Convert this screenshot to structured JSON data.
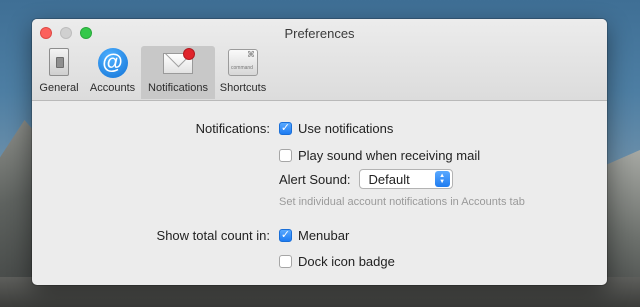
{
  "window": {
    "title": "Preferences"
  },
  "toolbar": {
    "items": [
      {
        "label": "General",
        "icon": "general-switch-icon"
      },
      {
        "label": "Accounts",
        "icon": "at-sign-icon"
      },
      {
        "label": "Notifications",
        "icon": "mail-notification-icon",
        "selected": true
      },
      {
        "label": "Shortcuts",
        "icon": "command-key-icon"
      }
    ]
  },
  "notifications": {
    "section_label": "Notifications:",
    "use_notifications": {
      "label": "Use notifications",
      "checked": true
    },
    "play_sound": {
      "label": "Play sound when receiving mail",
      "checked": false
    },
    "alert_sound": {
      "label": "Alert Sound:",
      "value": "Default"
    },
    "hint": "Set individual account notifications in Accounts tab"
  },
  "count": {
    "section_label": "Show total count in:",
    "menubar": {
      "label": "Menubar",
      "checked": true
    },
    "dock_badge": {
      "label": "Dock icon badge",
      "checked": false
    }
  },
  "colors": {
    "accent": "#1e7cf2",
    "close": "#fc605c",
    "maximize": "#34c84a",
    "badge": "#e0232b"
  }
}
